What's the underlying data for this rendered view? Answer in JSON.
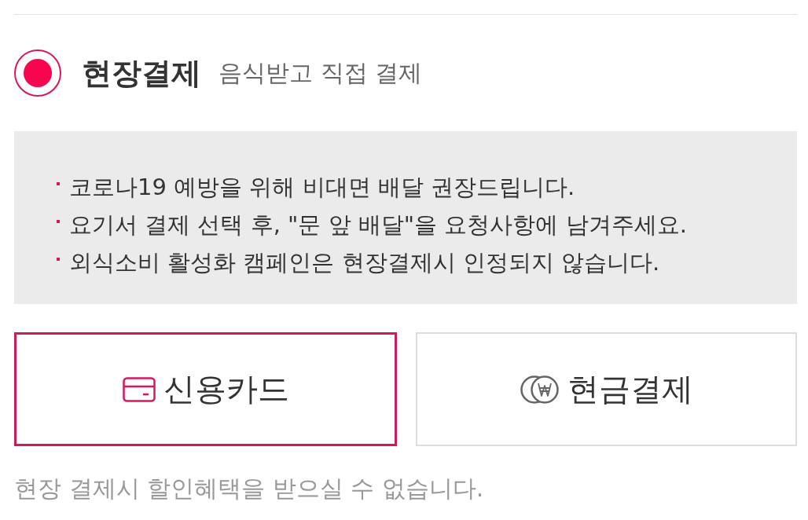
{
  "payment_option": {
    "selected": true,
    "title": "현장결제",
    "subtitle": "음식받고 직접 결제"
  },
  "notices": [
    "코로나19 예방을 위해 비대면 배달 권장드립니다.",
    "요기서 결제 선택 후, \"문 앞 배달\"을 요청사항에 남겨주세요.",
    "외식소비 활성화 캠페인은 현장결제시 인정되지 않습니다."
  ],
  "methods": [
    {
      "kind": "card",
      "label": "신용카드",
      "selected": true
    },
    {
      "kind": "cash",
      "label": "현금결제",
      "selected": false
    }
  ],
  "footnote": "현장 결제시 할인혜택을 받으실 수 없습니다."
}
